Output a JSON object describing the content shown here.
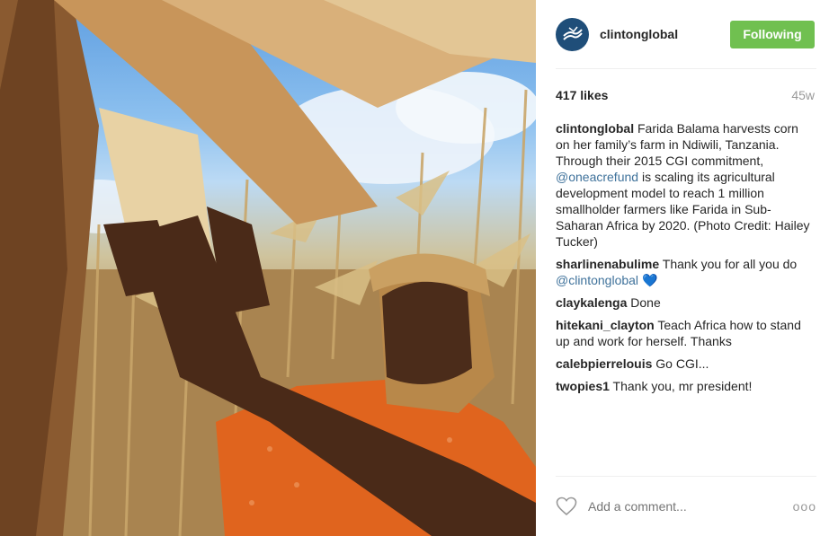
{
  "post": {
    "username": "clintonglobal",
    "follow_label": "Following",
    "likes": "417 likes",
    "age": "45w",
    "caption": {
      "user": "clintonglobal",
      "text_before": " Farida Balama harvests corn on her family’s farm in Ndiwili, Tanzania. Through their 2015 CGI commitment, ",
      "mention": "@oneacrefund",
      "text_after": " is scaling its agricultural development model to reach 1 million smallholder farmers like Farida in Sub-Saharan Africa by 2020. (Photo Credit: Hailey Tucker)"
    },
    "comments": [
      {
        "user": "sharlinenabulime",
        "text": " Thank you for all you do ",
        "mention": "@clintonglobal",
        "emoji": "💙"
      },
      {
        "user": "claykalenga",
        "text": " Done"
      },
      {
        "user": "hitekani_clayton",
        "text": " Teach Africa how to stand up and work for herself. Thanks"
      },
      {
        "user": "calebpierrelouis",
        "text": " Go CGI..."
      },
      {
        "user": "twopies1",
        "text": " Thank you, mr president!"
      }
    ],
    "add_comment_placeholder": "Add a comment...",
    "more_label": "ooo"
  },
  "icons": {
    "avatar": "clinton-global-logo",
    "heart": "heart-outline-icon",
    "more": "more-options-icon"
  },
  "colors": {
    "follow_button": "#70c050",
    "mention": "#3f729b",
    "avatar_bg": "#1f4e79",
    "muted": "#999999"
  }
}
